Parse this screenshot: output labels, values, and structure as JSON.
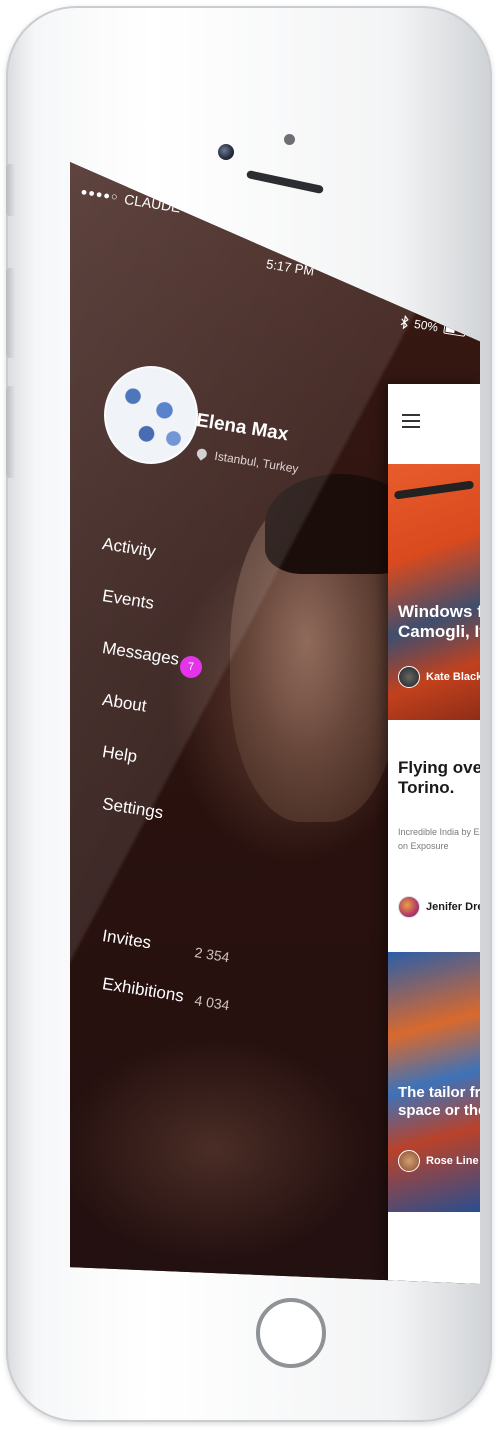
{
  "status_bar": {
    "signal": "●●●●○",
    "carrier": "CLAUDE",
    "time": "5:17 PM",
    "battery": "50%"
  },
  "profile": {
    "name": "Elena Max",
    "location": "Istanbul, Turkey"
  },
  "menu": {
    "items": [
      {
        "label": "Activity"
      },
      {
        "label": "Events"
      },
      {
        "label": "Messages",
        "badge": "7"
      },
      {
        "label": "About"
      },
      {
        "label": "Help"
      },
      {
        "label": "Settings"
      }
    ]
  },
  "stats": [
    {
      "label": "Invites",
      "value": "2 354"
    },
    {
      "label": "Exhibitions",
      "value": "4 034"
    }
  ],
  "cards": [
    {
      "title": "Windows fr\nCamogli, Ita",
      "author": "Kate Black"
    },
    {
      "title": "Flying over\nTorino.",
      "description": "Incredible India by E\non Exposure",
      "author": "Jenifer Dre"
    },
    {
      "title": "The tailor fro\nspace or the",
      "author": "Rose Line"
    }
  ],
  "colors": {
    "badge": "#e01ce8",
    "screen_bg": "#2a1310"
  },
  "icons": {
    "wifi": "wifi-icon",
    "bluetooth": "bluetooth-icon",
    "location": "pin-icon",
    "menu": "hamburger-icon"
  }
}
